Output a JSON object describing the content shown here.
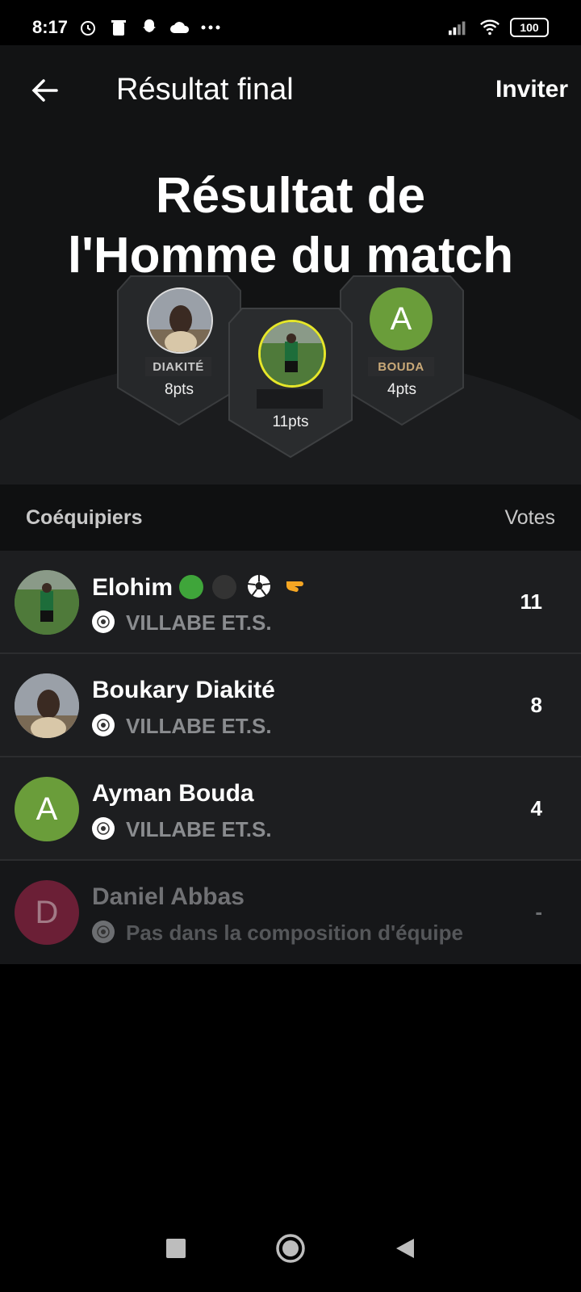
{
  "status": {
    "time": "8:17",
    "battery": "100"
  },
  "header": {
    "title": "Résultat final",
    "invite_label": "Inviter"
  },
  "hero": {
    "title_line1": "Résultat de",
    "title_line2": "l'Homme du match",
    "podium": [
      {
        "name": "DIAKITÉ",
        "points": "8pts",
        "avatar": "photo"
      },
      {
        "name": "",
        "points": "11pts",
        "avatar": "photo"
      },
      {
        "name": "BOUDA",
        "points": "4pts",
        "avatar_letter": "A"
      }
    ]
  },
  "section": {
    "left": "Coéquipiers",
    "right": "Votes"
  },
  "players": [
    {
      "name": "Elohim",
      "emoji": [
        "green-circle",
        "black-circle",
        "soccer-ball",
        "hand"
      ],
      "team": "VILLABE ET.S.",
      "votes": "11"
    },
    {
      "name": "Boukary Diakité",
      "team": "VILLABE ET.S.",
      "votes": "8"
    },
    {
      "name": "Ayman Bouda",
      "team": "VILLABE ET.S.",
      "votes": "4",
      "avatar_letter": "A"
    },
    {
      "name": "Daniel Abbas",
      "team": "Pas dans la composition d'équipe",
      "votes": "-",
      "avatar_letter": "D"
    }
  ],
  "colors": {
    "green_avatar": "#6a9d3a",
    "maroon_avatar": "#6b1f36",
    "highlight_ring": "#e6e62a",
    "background": "#121314"
  }
}
